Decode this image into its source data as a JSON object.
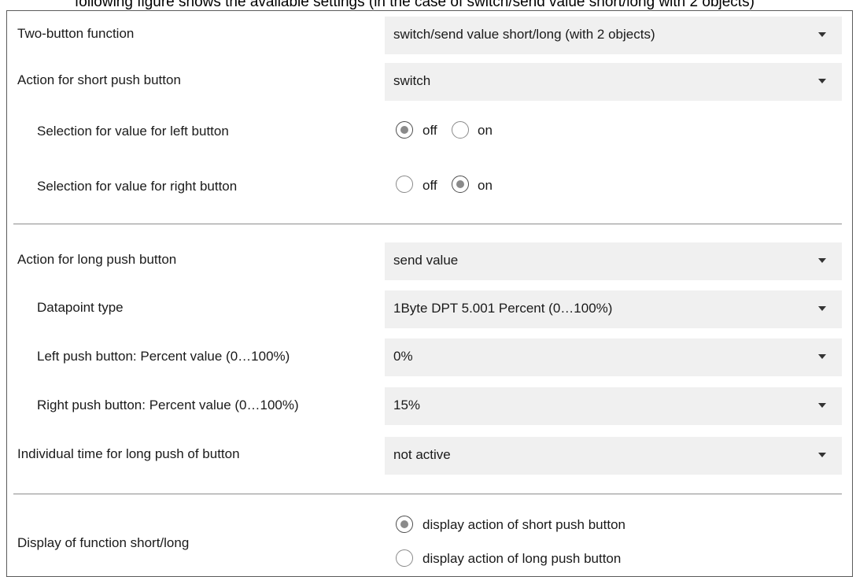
{
  "top_text": "following figure shows the available settings (in the case of switch/send value short/long with 2 objects)",
  "rows": {
    "two_button_function": {
      "label": "Two-button function",
      "value": "switch/send value short/long (with 2 objects)"
    },
    "short_action": {
      "label": "Action for short push button",
      "value": "switch"
    },
    "left_value": {
      "label": "Selection for value for left button",
      "opt_off": "off",
      "opt_on": "on",
      "selected": "off"
    },
    "right_value": {
      "label": "Selection for value for right button",
      "opt_off": "off",
      "opt_on": "on",
      "selected": "on"
    },
    "long_action": {
      "label": "Action for long push button",
      "value": "send value"
    },
    "datapoint_type": {
      "label": "Datapoint type",
      "value": "1Byte DPT 5.001 Percent (0…100%)"
    },
    "left_percent": {
      "label": "Left push button: Percent value (0…100%)",
      "value": "0%"
    },
    "right_percent": {
      "label": "Right push button: Percent value (0…100%)",
      "value": "15%"
    },
    "individual_time": {
      "label": "Individual time for long push of button",
      "value": "not active"
    },
    "display_function": {
      "label": "Display of function short/long",
      "opt_short": "display action of short push button",
      "opt_long": "display action of long push button",
      "selected": "short"
    }
  }
}
